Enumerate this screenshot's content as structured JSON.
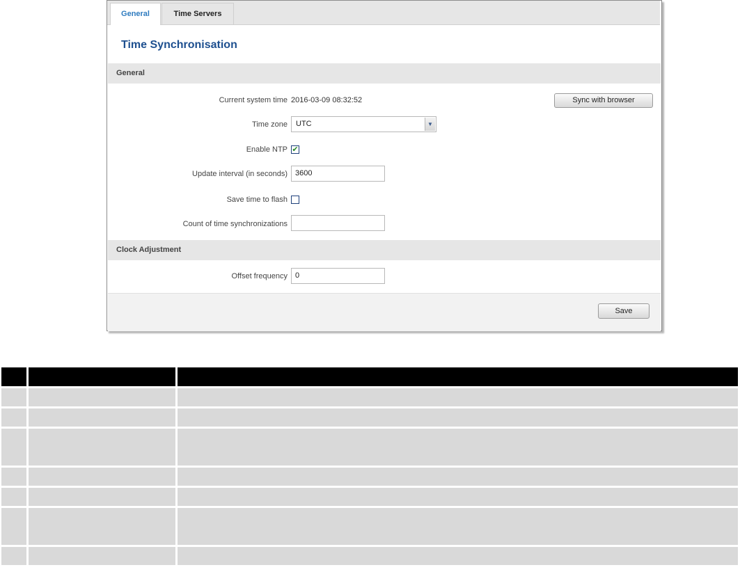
{
  "tabs": [
    {
      "label": "General",
      "active": true
    },
    {
      "label": "Time Servers",
      "active": false
    }
  ],
  "page_title": "Time Synchronisation",
  "sections": {
    "general": "General",
    "clock_adjustment": "Clock Adjustment"
  },
  "fields": {
    "current_time_label": "Current system time",
    "current_time_value": "2016-03-09 08:32:52",
    "sync_button": "Sync with browser",
    "timezone_label": "Time zone",
    "timezone_value": "UTC",
    "enable_ntp_label": "Enable NTP",
    "enable_ntp_checked": true,
    "update_interval_label": "Update interval (in seconds)",
    "update_interval_value": "3600",
    "save_flash_label": "Save time to flash",
    "save_flash_checked": false,
    "count_sync_label": "Count of time synchronizations",
    "count_sync_value": "",
    "offset_freq_label": "Offset frequency",
    "offset_freq_value": "0"
  },
  "save_button": "Save",
  "table": {
    "header": [
      "",
      "",
      ""
    ],
    "rows": [
      {
        "tall": false
      },
      {
        "tall": false
      },
      {
        "tall": true
      },
      {
        "tall": false
      },
      {
        "tall": false
      },
      {
        "tall": true
      },
      {
        "tall": false
      }
    ]
  },
  "colors": {
    "accent_tab": "#2e7bbf",
    "title": "#1d4f8f",
    "section_bg": "#e6e6e6",
    "checkbox_mark": "#2a8a2a"
  }
}
